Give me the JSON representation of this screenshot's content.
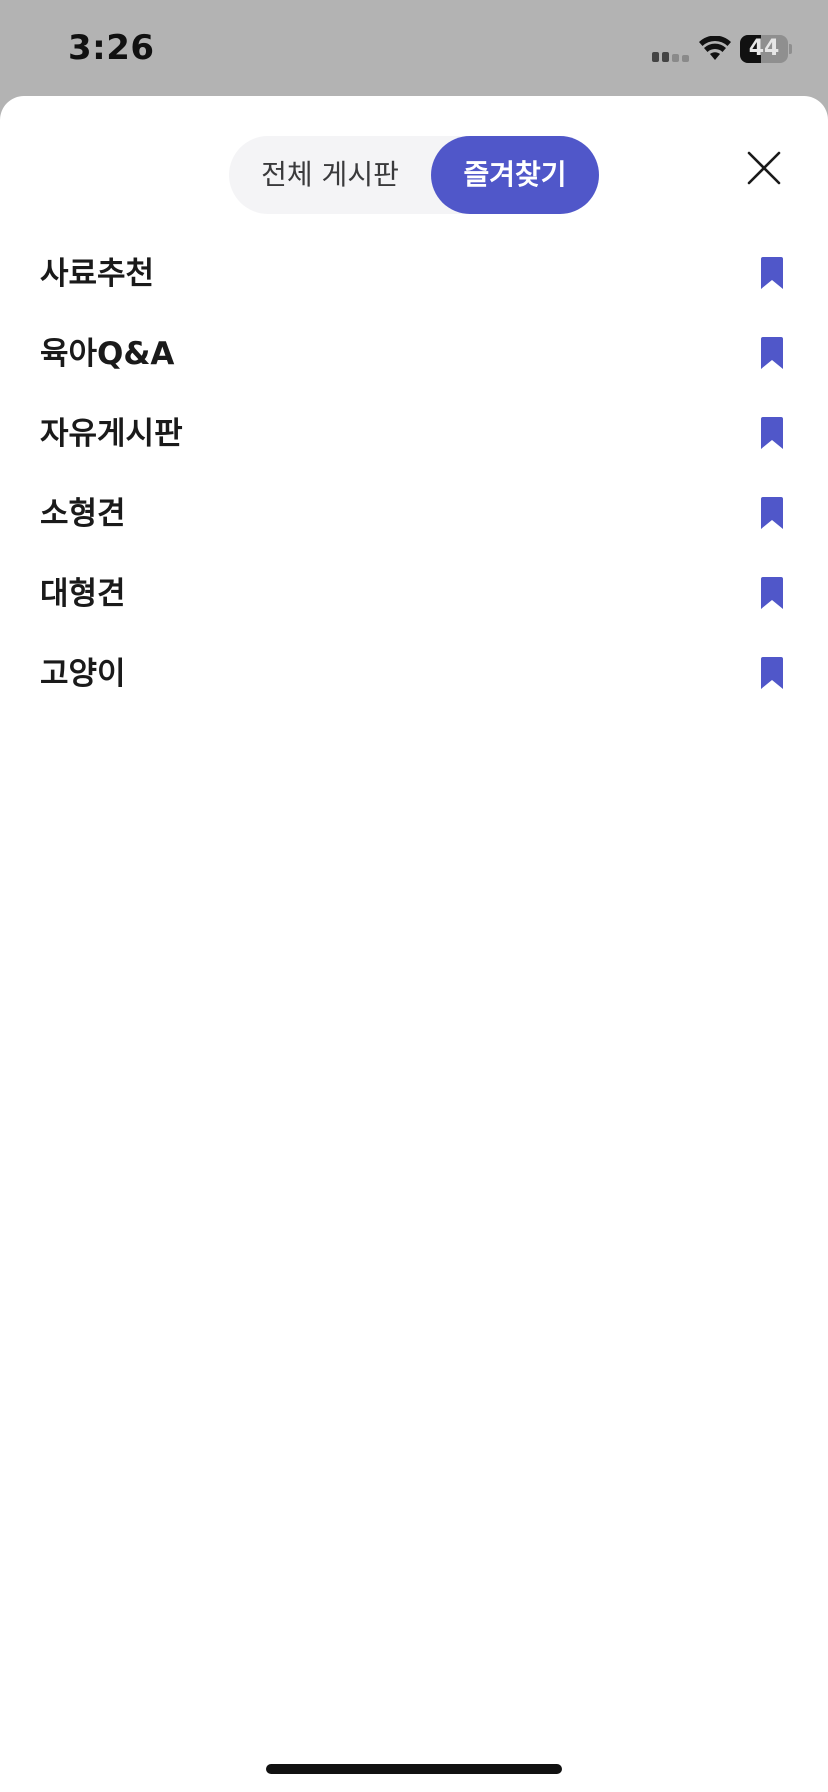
{
  "status_bar": {
    "time": "3:26",
    "battery_level": "44",
    "battery_fraction": 0.44,
    "icons": [
      "signal-icon",
      "wifi-icon",
      "battery-icon"
    ]
  },
  "segment": {
    "tabs": [
      {
        "label": "전체 게시판",
        "selected": false
      },
      {
        "label": "즐겨찾기",
        "selected": true
      }
    ]
  },
  "favorites": [
    {
      "label": "사료추천",
      "icon": "bookmark-icon"
    },
    {
      "label": "육아Q&A",
      "icon": "bookmark-icon"
    },
    {
      "label": "자유게시판",
      "icon": "bookmark-icon"
    },
    {
      "label": "소형견",
      "icon": "bookmark-icon"
    },
    {
      "label": "대형견",
      "icon": "bookmark-icon"
    },
    {
      "label": "고양이",
      "icon": "bookmark-icon"
    }
  ],
  "colors": {
    "accent": "#5057c9",
    "text": "#1a1a1a",
    "segment_bg": "#f4f4f6",
    "backdrop": "#b3b3b3"
  },
  "close_icon": "close-icon"
}
